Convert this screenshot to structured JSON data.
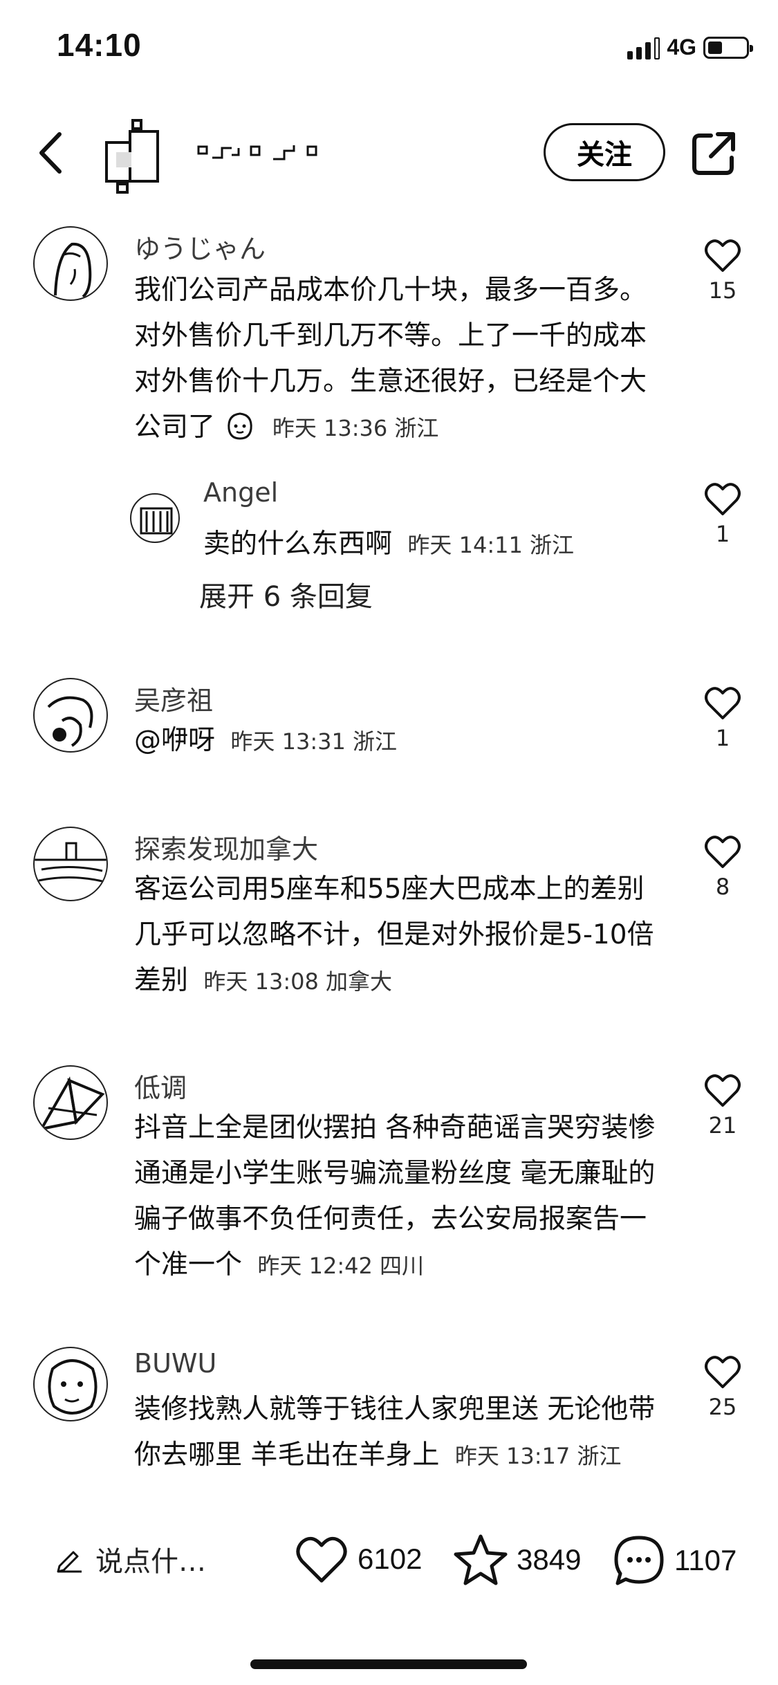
{
  "status_bar": {
    "time": "14:10",
    "network": "4G"
  },
  "header": {
    "follow_label": "关注"
  },
  "comments": [
    {
      "user": "ゆうじゃん",
      "text": "我们公司产品成本价几十块，最多一百多。对外售价几千到几万不等。上了一千的成本对外售价十几万。生意还很好，已经是个大公司了",
      "meta": "昨天 13:36 浙江",
      "likes": "15",
      "reply": {
        "user": "Angel",
        "text": "卖的什么东西啊",
        "meta": "昨天 14:11 浙江",
        "likes": "1"
      },
      "expand_label": "展开 6 条回复"
    },
    {
      "user": "吴彦祖",
      "text": "@咿呀",
      "meta": "昨天 13:31 浙江",
      "likes": "1"
    },
    {
      "user": "探索发现加拿大",
      "text": "客运公司用5座车和55座大巴成本上的差别几乎可以忽略不计，但是对外报价是5-10倍差别",
      "meta": "昨天 13:08 加拿大",
      "likes": "8"
    },
    {
      "user": "低调",
      "text": "抖音上全是团伙摆拍 各种奇葩谣言哭穷装惨通通是小学生账号骗流量粉丝度  毫无廉耻的骗子做事不负任何责任，去公安局报案告一个准一个",
      "meta": "昨天 12:42 四川",
      "likes": "21"
    },
    {
      "user": "BUWU",
      "text": "装修找熟人就等于钱往人家兜里送 无论他带你去哪里 羊毛出在羊身上",
      "meta": "昨天 13:17 浙江",
      "likes": "25"
    }
  ],
  "bottom_bar": {
    "compose_placeholder": "说点什…",
    "likes": "6102",
    "favorites": "3849",
    "comments": "1107"
  },
  "icons": [
    "back-chevron-icon",
    "share-icon",
    "heart-icon",
    "star-icon",
    "comment-bubble-icon",
    "pencil-icon",
    "smile-emoji-icon"
  ]
}
